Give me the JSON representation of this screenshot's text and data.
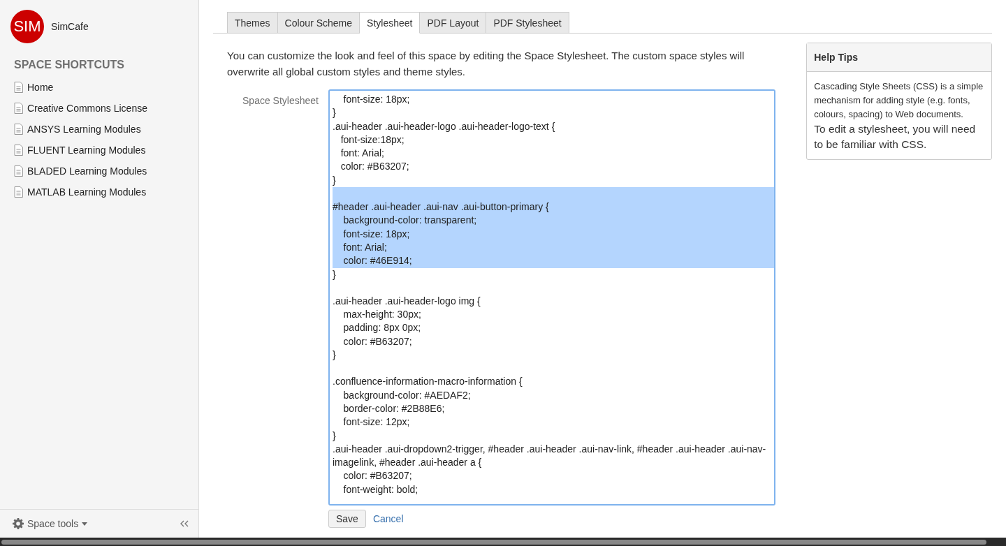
{
  "space": {
    "logo": "SIM",
    "name": "SimCafe"
  },
  "sidebar": {
    "heading": "SPACE SHORTCUTS",
    "items": [
      "Home",
      "Creative Commons License",
      "ANSYS Learning Modules",
      "FLUENT Learning Modules",
      "BLADED Learning Modules",
      "MATLAB Learning Modules"
    ],
    "tools": "Space tools"
  },
  "tabs": [
    {
      "label": "Themes",
      "selected": false
    },
    {
      "label": "Colour Scheme",
      "selected": false
    },
    {
      "label": "Stylesheet",
      "selected": true
    },
    {
      "label": "PDF Layout",
      "selected": false
    },
    {
      "label": "PDF Stylesheet",
      "selected": false
    }
  ],
  "intro": "You can customize the look and feel of this space by editing the Space Stylesheet. The custom space styles will overwrite all global custom styles and theme styles.",
  "editor": {
    "label": "Space Stylesheet",
    "lines": [
      {
        "text": "    font-size: 18px;",
        "selected": false
      },
      {
        "text": "}",
        "selected": false
      },
      {
        "text": ".aui-header .aui-header-logo .aui-header-logo-text {",
        "selected": false
      },
      {
        "text": "   font-size:18px;",
        "selected": false
      },
      {
        "text": "   font: Arial;",
        "selected": false
      },
      {
        "text": "   color: #B63207;",
        "selected": false
      },
      {
        "text": "}",
        "selected": false
      },
      {
        "text": "#header .aui-header .aui-nav .aui-button-primary {",
        "selected": true,
        "blank_before": true
      },
      {
        "text": "    background-color: transparent;",
        "selected": true
      },
      {
        "text": "    font-size: 18px;",
        "selected": true
      },
      {
        "text": "    font: Arial;",
        "selected": true
      },
      {
        "text": "    color: #46E914;",
        "selected": true
      },
      {
        "text": "}",
        "selected": false
      },
      {
        "text": ".aui-header .aui-header-logo img {",
        "selected": false,
        "blank_before": true
      },
      {
        "text": "    max-height: 30px;",
        "selected": false
      },
      {
        "text": "    padding: 8px 0px;",
        "selected": false
      },
      {
        "text": "    color: #B63207;",
        "selected": false
      },
      {
        "text": "}",
        "selected": false
      },
      {
        "text": ".confluence-information-macro-information {",
        "selected": false,
        "blank_before": true
      },
      {
        "text": "    background-color: #AEDAF2;",
        "selected": false
      },
      {
        "text": "    border-color: #2B88E6;",
        "selected": false
      },
      {
        "text": "    font-size: 12px;",
        "selected": false
      },
      {
        "text": "}",
        "selected": false
      },
      {
        "text": ".aui-header .aui-dropdown2-trigger, #header .aui-header .aui-nav-link, #header .aui-header .aui-nav-imagelink, #header .aui-header a {",
        "selected": false
      },
      {
        "text": "    color: #B63207;",
        "selected": false
      },
      {
        "text": "    font-weight: bold;",
        "selected": false
      }
    ]
  },
  "actions": {
    "save": "Save",
    "cancel": "Cancel"
  },
  "help": {
    "title": "Help Tips",
    "body": "Cascading Style Sheets (CSS) is a simple mechanism for adding style (e.g. fonts, colours, spacing) to Web documents.",
    "note": "To edit a stylesheet, you will need to be familiar with CSS."
  }
}
